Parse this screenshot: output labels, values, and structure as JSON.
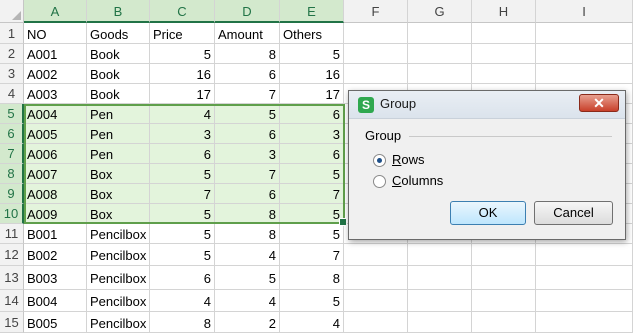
{
  "columns": [
    "A",
    "B",
    "C",
    "D",
    "E",
    "F",
    "G",
    "H",
    "I"
  ],
  "rows": [
    {
      "num": "1",
      "cells": [
        "NO",
        "Goods",
        "Price",
        "Amount",
        "Others"
      ]
    },
    {
      "num": "2",
      "cells": [
        "A001",
        "Book",
        "5",
        "8",
        "5"
      ]
    },
    {
      "num": "3",
      "cells": [
        "A002",
        "Book",
        "16",
        "6",
        "16"
      ]
    },
    {
      "num": "4",
      "cells": [
        "A003",
        "Book",
        "17",
        "7",
        "17"
      ]
    },
    {
      "num": "5",
      "cells": [
        "A004",
        "Pen",
        "4",
        "5",
        "6"
      ]
    },
    {
      "num": "6",
      "cells": [
        "A005",
        "Pen",
        "3",
        "6",
        "3"
      ]
    },
    {
      "num": "7",
      "cells": [
        "A006",
        "Pen",
        "6",
        "3",
        "6"
      ]
    },
    {
      "num": "8",
      "cells": [
        "A007",
        "Box",
        "5",
        "7",
        "5"
      ]
    },
    {
      "num": "9",
      "cells": [
        "A008",
        "Box",
        "7",
        "6",
        "7"
      ]
    },
    {
      "num": "10",
      "cells": [
        "A009",
        "Box",
        "5",
        "8",
        "5"
      ]
    },
    {
      "num": "11",
      "cells": [
        "B001",
        "Pencilbox",
        "5",
        "8",
        "5"
      ]
    },
    {
      "num": "12",
      "cells": [
        "B002",
        "Pencilbox",
        "5",
        "4",
        "7"
      ]
    },
    {
      "num": "13",
      "cells": [
        "B003",
        "Pencilbox",
        "6",
        "5",
        "8"
      ]
    },
    {
      "num": "14",
      "cells": [
        "B004",
        "Pencilbox",
        "4",
        "4",
        "5"
      ]
    },
    {
      "num": "15",
      "cells": [
        "B005",
        "Pencilbox",
        "8",
        "2",
        "4"
      ]
    }
  ],
  "selected_range": {
    "first_row": "5",
    "last_row": "10",
    "first_col": "A",
    "last_col": "E"
  },
  "dialog": {
    "title": "Group",
    "app_icon": "S",
    "close_icon": "close-icon",
    "section_label": "Group",
    "options": [
      {
        "label": "Rows",
        "selected": true
      },
      {
        "label": "Columns",
        "selected": false
      }
    ],
    "ok_label": "OK",
    "cancel_label": "Cancel",
    "close_glyph": "✕"
  },
  "colors": {
    "selection_green": "#217346",
    "selection_fill": "#e3f4dc"
  }
}
